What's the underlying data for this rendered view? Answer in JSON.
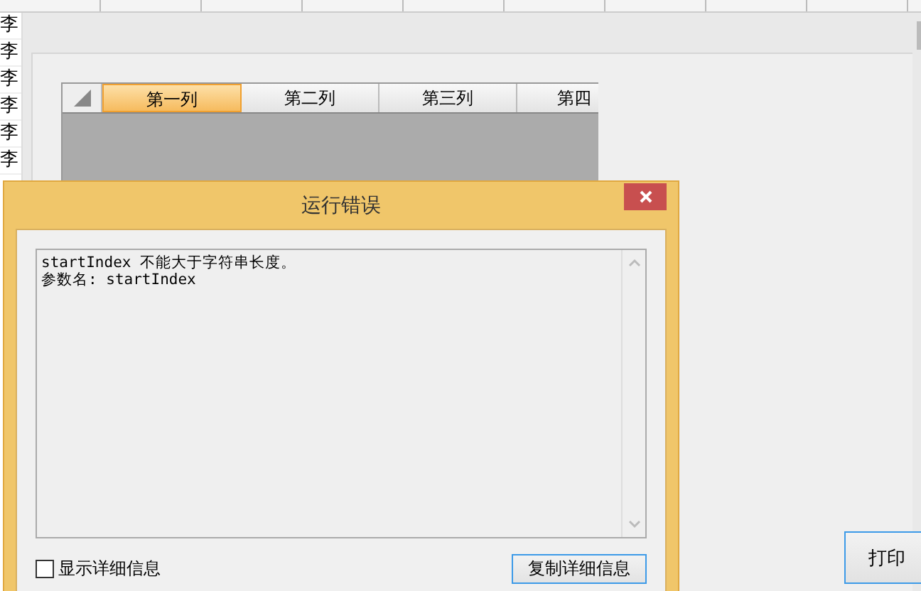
{
  "background": {
    "row_labels": [
      "李",
      "李",
      "李",
      "李",
      "李",
      "李"
    ],
    "grid": {
      "columns": [
        {
          "label": "第一列",
          "selected": true
        },
        {
          "label": "第二列",
          "selected": false
        },
        {
          "label": "第三列",
          "selected": false
        },
        {
          "label": "第四",
          "selected": false
        }
      ]
    },
    "print_button": "打印"
  },
  "dialog": {
    "title": "运行错误",
    "message_lines": [
      "startIndex 不能大于字符串长度。",
      "参数名: startIndex"
    ],
    "show_details": {
      "label": "显示详细信息",
      "checked": false
    },
    "copy_button": "复制详细信息"
  }
}
